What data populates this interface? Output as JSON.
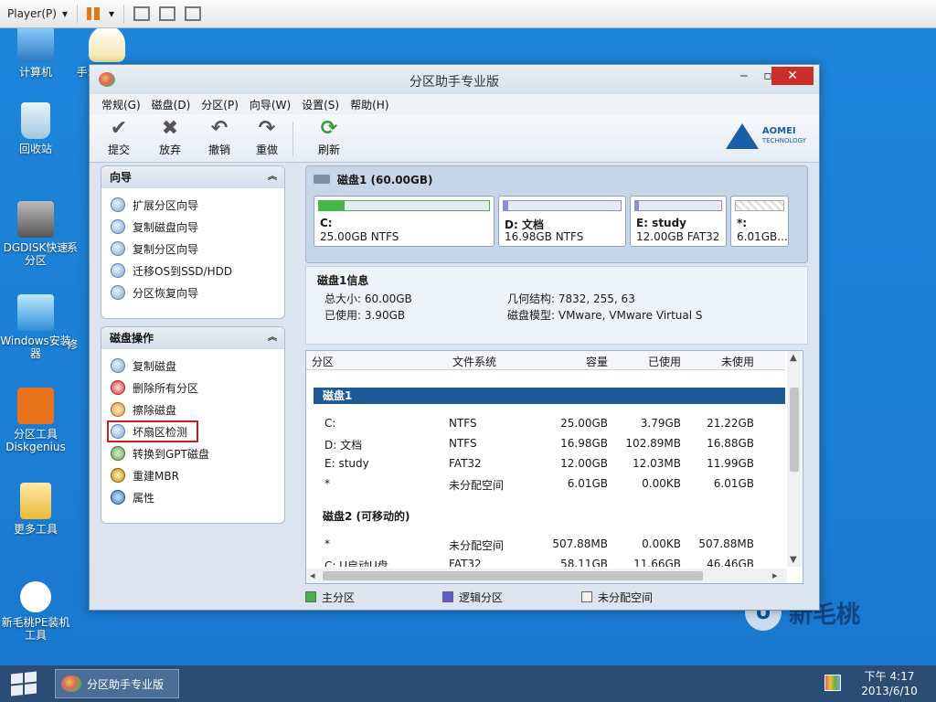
{
  "player": {
    "menu_label": "Player(P)"
  },
  "desktop": {
    "icons": [
      {
        "label": "计算机"
      },
      {
        "label": "手动GHOST"
      },
      {
        "label": "回收站"
      },
      {
        "label": "DGDISK快速分区"
      },
      {
        "label": "系"
      },
      {
        "label": "Windows安装器"
      },
      {
        "label": "修"
      },
      {
        "label": "分区工具Diskgenius"
      },
      {
        "label": "更多工具"
      },
      {
        "label": "新毛桃PE装机工具"
      }
    ],
    "brand": "新毛桃"
  },
  "window": {
    "title": "分区助手专业版",
    "menu": [
      "常规(G)",
      "磁盘(D)",
      "分区(P)",
      "向导(W)",
      "设置(S)",
      "帮助(H)"
    ],
    "toolbar": [
      "提交",
      "放弃",
      "撤销",
      "重做",
      "刷新"
    ],
    "brand": {
      "name": "AOMEI",
      "sub": "TECHNOLOGY"
    }
  },
  "wizard_panel": {
    "title": "向导",
    "items": [
      "扩展分区向导",
      "复制磁盘向导",
      "复制分区向导",
      "迁移OS到SSD/HDD",
      "分区恢复向导"
    ]
  },
  "disk_ops_panel": {
    "title": "磁盘操作",
    "items": [
      "复制磁盘",
      "删除所有分区",
      "擦除磁盘",
      "坏扇区检测",
      "转换到GPT磁盘",
      "重建MBR",
      "属性"
    ],
    "highlighted": "坏扇区检测"
  },
  "disk": {
    "title": "磁盘1 (60.00GB)",
    "partitions": [
      {
        "label": "C:",
        "size": "25.00GB NTFS",
        "used_fraction": 0.15,
        "color": "#44b548"
      },
      {
        "label": "D: 文档",
        "size": "16.98GB NTFS",
        "used_fraction": 0.01,
        "color": "#8c8fe0"
      },
      {
        "label": "E: study",
        "size": "12.00GB FAT32",
        "used_fraction": 0.01,
        "color": "#8c8fe0"
      },
      {
        "label": "*:",
        "size": "6.01GB...",
        "used_fraction": 0.0,
        "color": "#e8e8e8"
      }
    ]
  },
  "disk_info": {
    "title": "磁盘1信息",
    "total": "总大小: 60.00GB",
    "used": "已使用: 3.90GB",
    "geometry": "几何结构: 7832, 255, 63",
    "model": "磁盘模型: VMware, VMware Virtual S"
  },
  "table": {
    "headers": [
      "分区",
      "文件系统",
      "容量",
      "已使用",
      "未使用"
    ],
    "groups": [
      {
        "name": "磁盘1",
        "rows": [
          [
            "C:",
            "NTFS",
            "25.00GB",
            "3.79GB",
            "21.22GB"
          ],
          [
            "D: 文档",
            "NTFS",
            "16.98GB",
            "102.89MB",
            "16.88GB"
          ],
          [
            "E: study",
            "FAT32",
            "12.00GB",
            "12.03MB",
            "11.99GB"
          ],
          [
            "*",
            "未分配空间",
            "6.01GB",
            "0.00KB",
            "6.01GB"
          ]
        ]
      },
      {
        "name": "磁盘2 (可移动的)",
        "rows": [
          [
            "*",
            "未分配空间",
            "507.88MB",
            "0.00KB",
            "507.88MB"
          ],
          [
            "C: U启动U盘",
            "FAT32",
            "58.11GB",
            "11.66GB",
            "46.46GB"
          ]
        ]
      }
    ]
  },
  "legend": [
    {
      "label": "主分区",
      "color": "#44b548"
    },
    {
      "label": "逻辑分区",
      "color": "#5a5fd6"
    },
    {
      "label": "未分配空间",
      "color": "#f2f2f2"
    }
  ],
  "taskbar": {
    "app": "分区助手专业版",
    "time": "下午 4:17",
    "date": "2013/6/10"
  }
}
